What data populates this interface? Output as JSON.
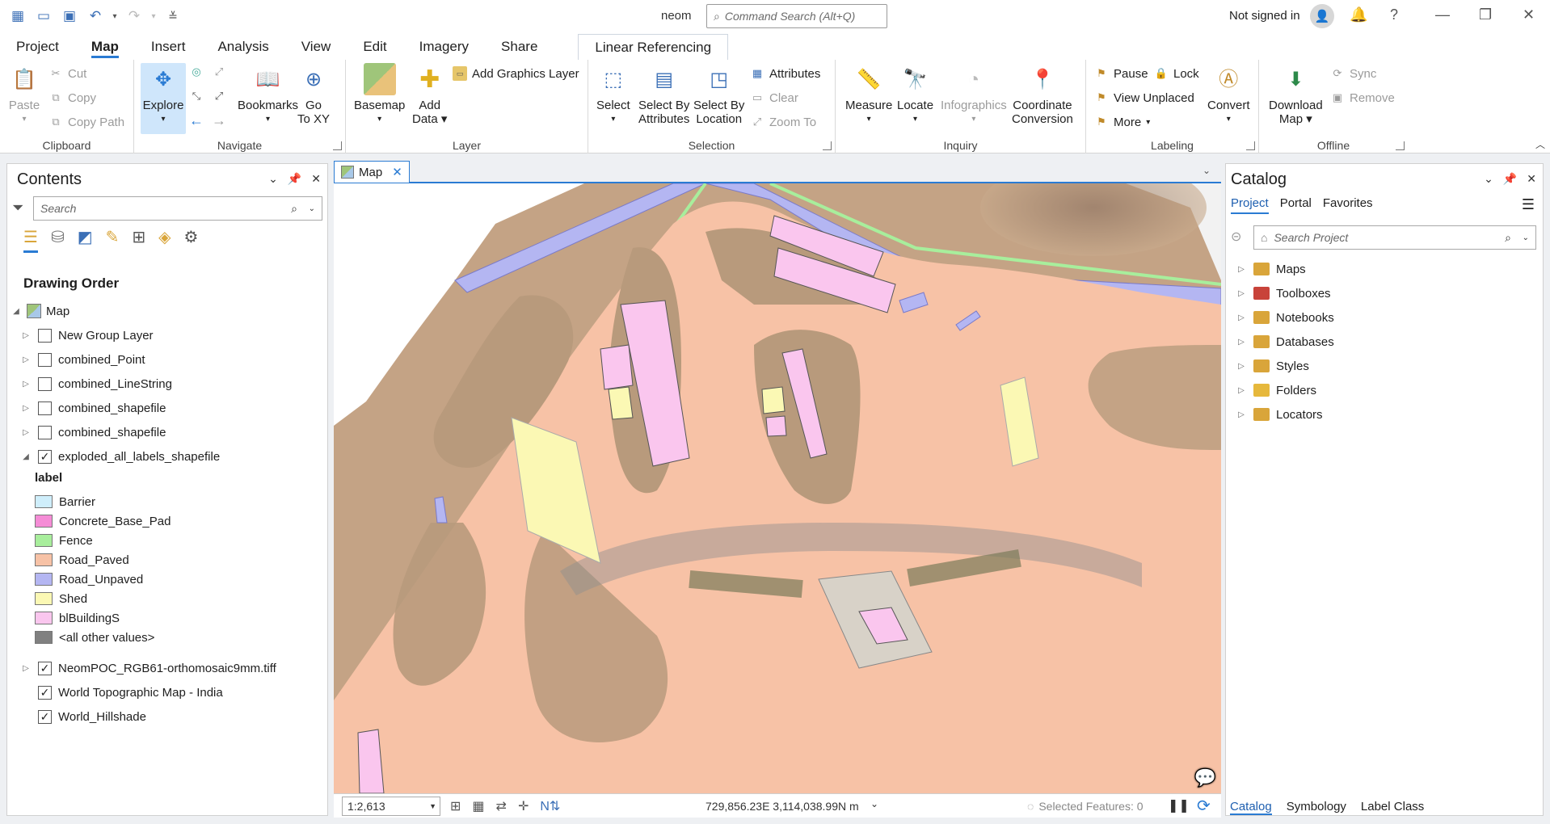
{
  "window": {
    "title": "neom",
    "signin_label": "Not signed in"
  },
  "command_search": {
    "placeholder": "Command Search (Alt+Q)"
  },
  "ribbon_tabs": [
    "Project",
    "Map",
    "Insert",
    "Analysis",
    "View",
    "Edit",
    "Imagery",
    "Share",
    "Linear Referencing"
  ],
  "active_tab": "Map",
  "ribbon": {
    "clipboard": {
      "label": "Clipboard",
      "paste": "Paste",
      "cut": "Cut",
      "copy": "Copy",
      "copy_path": "Copy Path"
    },
    "navigate": {
      "label": "Navigate",
      "explore": "Explore",
      "bookmarks": "Bookmarks",
      "goto_1": "Go",
      "goto_2": "To XY"
    },
    "layer": {
      "label": "Layer",
      "basemap": "Basemap",
      "add_data_1": "Add",
      "add_data_2": "Data",
      "add_graphics": "Add Graphics Layer"
    },
    "selection": {
      "label": "Selection",
      "select": "Select",
      "sel_attr_1": "Select By",
      "sel_attr_2": "Attributes",
      "sel_loc_1": "Select By",
      "sel_loc_2": "Location",
      "attributes": "Attributes",
      "clear": "Clear",
      "zoom_to": "Zoom To"
    },
    "inquiry": {
      "label": "Inquiry",
      "measure": "Measure",
      "locate": "Locate",
      "infographics": "Infographics",
      "coord_1": "Coordinate",
      "coord_2": "Conversion"
    },
    "labeling": {
      "label": "Labeling",
      "pause": "Pause",
      "lock": "Lock",
      "view_unplaced": "View Unplaced",
      "more": "More",
      "convert": "Convert"
    },
    "offline": {
      "label": "Offline",
      "download_1": "Download",
      "download_2": "Map",
      "sync": "Sync",
      "remove": "Remove"
    }
  },
  "contents": {
    "title": "Contents",
    "search_placeholder": "Search",
    "drawing_order": "Drawing Order",
    "map_label": "Map",
    "layers": [
      {
        "name": "New Group Layer",
        "checked": false
      },
      {
        "name": "combined_Point",
        "checked": false
      },
      {
        "name": "combined_LineString",
        "checked": false
      },
      {
        "name": "combined_shapefile",
        "checked": false
      },
      {
        "name": "combined_shapefile",
        "checked": false
      },
      {
        "name": "exploded_all_labels_shapefile",
        "checked": true
      }
    ],
    "legend_field": "label",
    "legend": [
      {
        "name": "Barrier",
        "color": "#cfeefb"
      },
      {
        "name": "Concrete_Base_Pad",
        "color": "#f58cd6"
      },
      {
        "name": "Fence",
        "color": "#a8ee9c"
      },
      {
        "name": "Road_Paved",
        "color": "#f7c2a6"
      },
      {
        "name": "Road_Unpaved",
        "color": "#b4b6f2"
      },
      {
        "name": "Shed",
        "color": "#fbf8b4"
      },
      {
        "name": "blBuildingS",
        "color": "#fac6ee"
      },
      {
        "name": "<all other values>",
        "color": "#808080"
      }
    ],
    "bottom_layers": [
      {
        "name": "NeomPOC_RGB61-orthomosaic9mm.tiff",
        "checked": true
      },
      {
        "name": "World Topographic Map - India",
        "checked": true
      },
      {
        "name": "World_Hillshade",
        "checked": true
      }
    ]
  },
  "map_tab": {
    "label": "Map"
  },
  "status": {
    "scale": "1:2,613",
    "coords": "729,856.23E 3,114,038.99N m",
    "selected": "Selected Features: 0"
  },
  "catalog": {
    "title": "Catalog",
    "tabs": [
      "Project",
      "Portal",
      "Favorites"
    ],
    "search_placeholder": "Search Project",
    "items": [
      {
        "name": "Maps",
        "color": "#d9a53a"
      },
      {
        "name": "Toolboxes",
        "color": "#c8433a"
      },
      {
        "name": "Notebooks",
        "color": "#d9a53a"
      },
      {
        "name": "Databases",
        "color": "#d9a53a"
      },
      {
        "name": "Styles",
        "color": "#d9a53a"
      },
      {
        "name": "Folders",
        "color": "#e6b83c"
      },
      {
        "name": "Locators",
        "color": "#d9a53a"
      }
    ],
    "bottom_tabs": [
      "Catalog",
      "Symbology",
      "Label Class"
    ]
  },
  "colors": {
    "accent": "#2a7bd3",
    "road_paved": "#f7c2a6",
    "road_unpaved": "#b4b6f2",
    "building": "#fac6ee",
    "shed": "#fbf8b4",
    "fence": "#a8ee9c"
  }
}
